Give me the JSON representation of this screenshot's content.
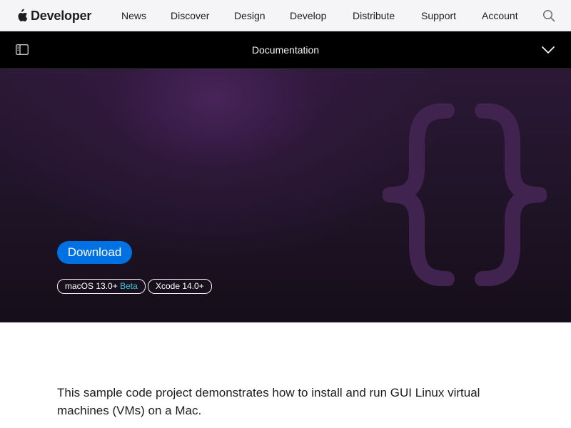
{
  "globalnav": {
    "brand": "Developer",
    "items": [
      "News",
      "Discover",
      "Design",
      "Develop",
      "Distribute",
      "Support",
      "Account"
    ],
    "icons": {
      "logo": "apple-logo-icon",
      "search": "search-icon"
    }
  },
  "docbar": {
    "title": "Documentation",
    "icons": {
      "toggle": "sidebar-toggle-icon",
      "menu": "chevron-down-icon"
    }
  },
  "hero": {
    "download_label": "Download",
    "badges": [
      {
        "text": "macOS 13.0+",
        "tag": "Beta"
      },
      {
        "text": "Xcode 14.0+",
        "tag": ""
      }
    ],
    "colors": {
      "accent": "#0071e3",
      "beta": "#39c6d6",
      "brace": "#40244f"
    }
  },
  "abstract": {
    "text": "This sample code project demonstrates how to install and run GUI Linux virtual machines (VMs) on a Mac."
  }
}
